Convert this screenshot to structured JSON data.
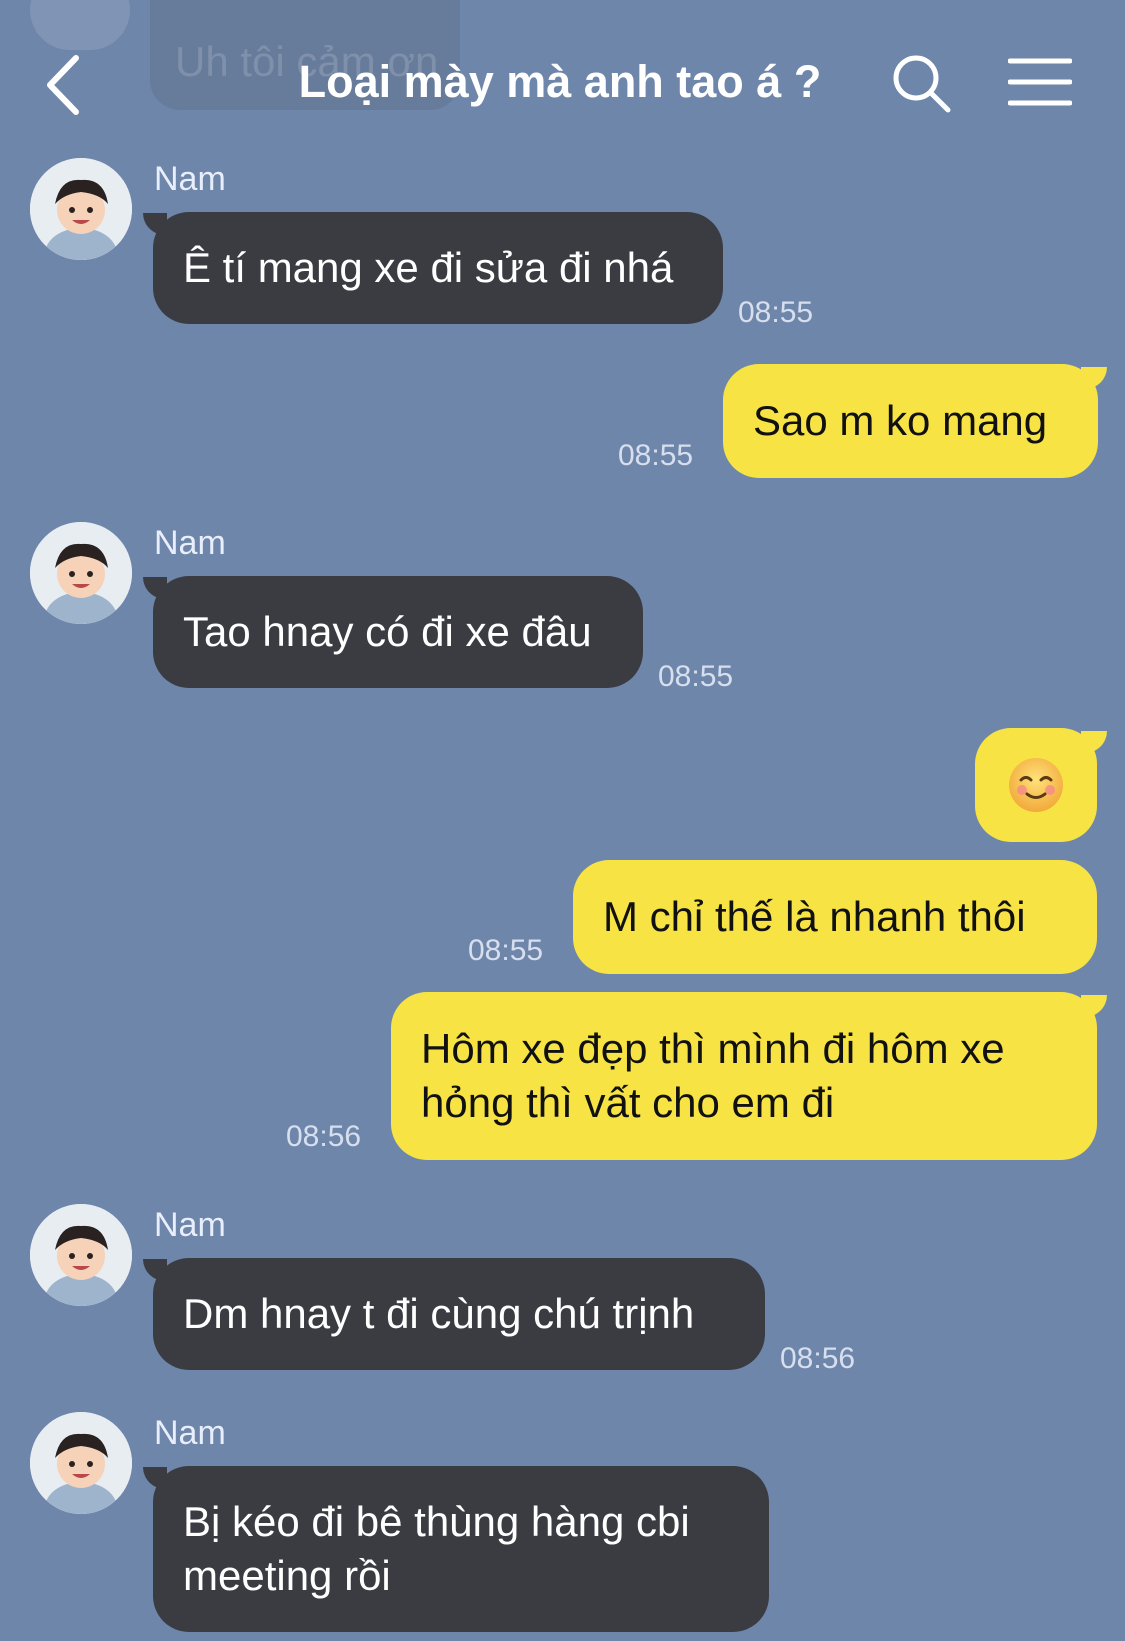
{
  "header": {
    "title": "Loại mày mà anh tao á ?",
    "ghost_text": "Uh tôi cảm ơn"
  },
  "messages": [
    {
      "id": "m1",
      "direction": "in",
      "sender": "Nam",
      "text": "Ê tí mang xe đi sửa đi nhá",
      "time": "08:55"
    },
    {
      "id": "m2",
      "direction": "out",
      "text": "Sao m ko mang",
      "time": "08:55"
    },
    {
      "id": "m3",
      "direction": "in",
      "sender": "Nam",
      "text": "Tao hnay có đi xe đâu",
      "time": "08:55"
    },
    {
      "id": "m4",
      "direction": "out",
      "text": "☺️"
    },
    {
      "id": "m5",
      "direction": "out",
      "text": "M chỉ thế là nhanh thôi",
      "time": "08:55"
    },
    {
      "id": "m6",
      "direction": "out",
      "line1": "Hôm xe đẹp thì mình đi hôm xe",
      "line2": "hỏng thì vất cho em đi",
      "time": "08:56"
    },
    {
      "id": "m7",
      "direction": "in",
      "sender": "Nam",
      "text": "Dm hnay t đi cùng chú trịnh",
      "time": "08:56"
    },
    {
      "id": "m8",
      "direction": "in",
      "sender": "Nam",
      "line1": "Bị kéo đi bê thùng hàng cbi",
      "line2": "meeting rồi"
    }
  ]
}
